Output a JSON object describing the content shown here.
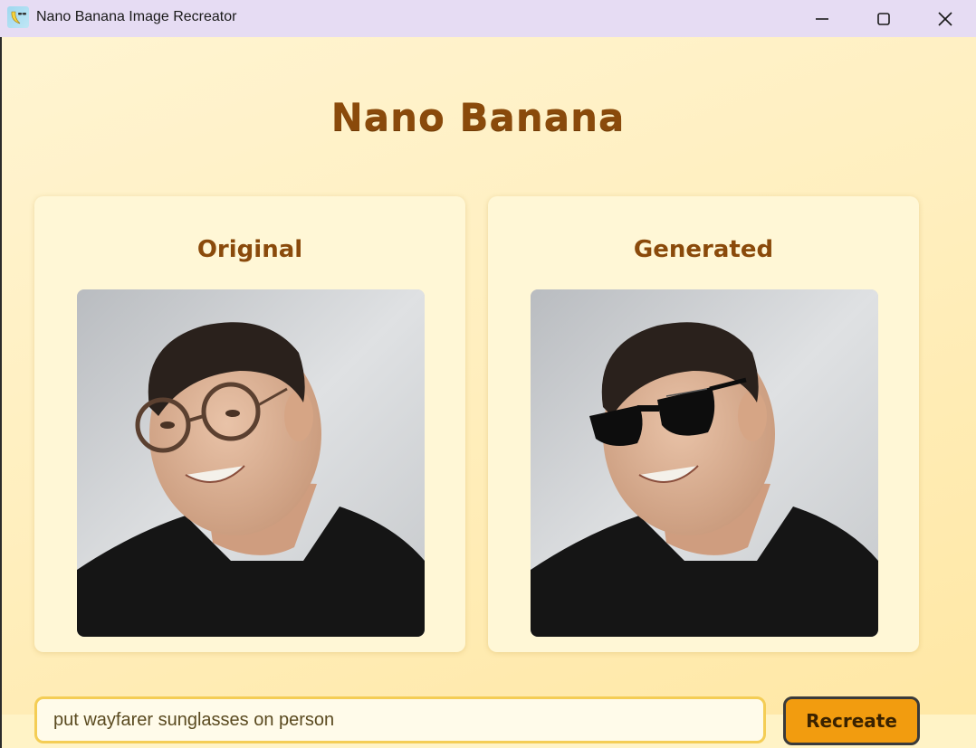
{
  "window": {
    "title": "Nano Banana Image Recreator",
    "icon": "banana-app-icon",
    "controls": [
      "minimize-icon",
      "maximize-icon",
      "close-icon"
    ]
  },
  "app": {
    "heading": "Nano Banana"
  },
  "panels": {
    "original": {
      "title": "Original",
      "image": "portrait-with-round-glasses"
    },
    "generated": {
      "title": "Generated",
      "image": "portrait-with-wayfarer-sunglasses"
    }
  },
  "prompt": {
    "value": "put wayfarer sunglasses on person",
    "placeholder": ""
  },
  "actions": {
    "recreate_label": "Recreate"
  },
  "colors": {
    "heading": "#8a4a0b",
    "button": "#f29c0f",
    "input_border": "#f4cd55",
    "background": "#ffefbf",
    "titlebar": "#e6dcf3"
  }
}
